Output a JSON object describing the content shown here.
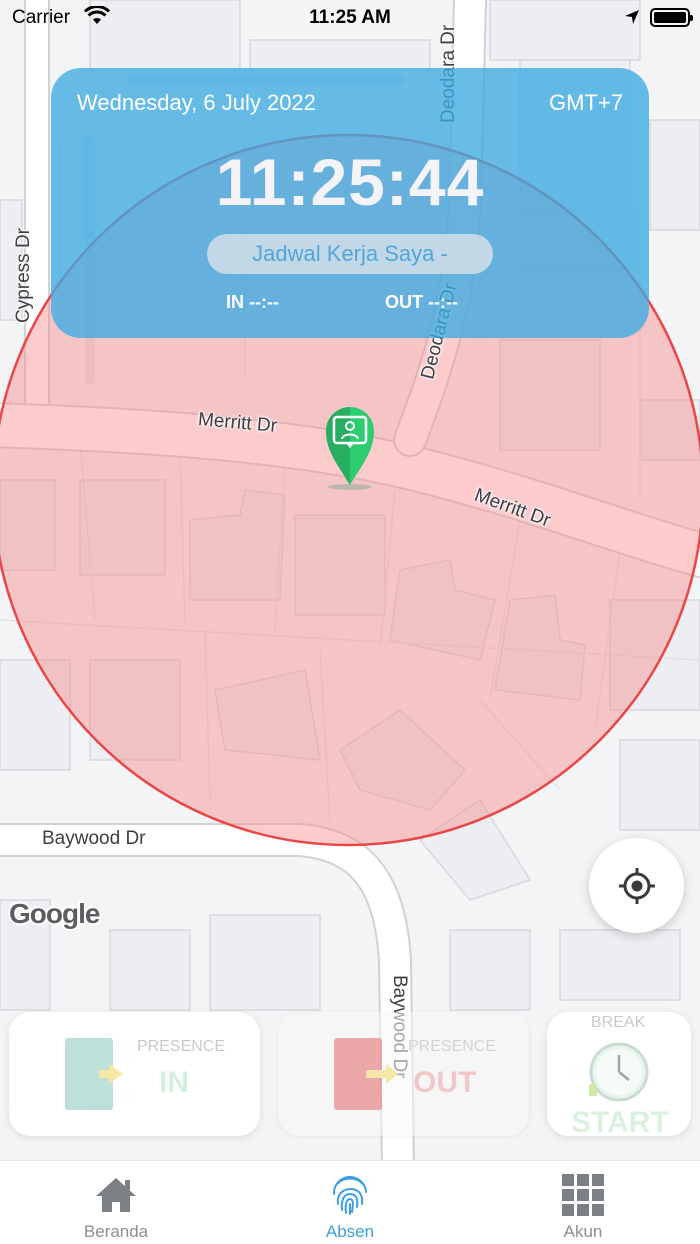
{
  "status_bar": {
    "carrier": "Carrier",
    "time": "11:25 AM"
  },
  "header": {
    "date": "Wednesday, 6 July 2022",
    "timezone": "GMT+7",
    "clock": "11:25:44",
    "schedule_label": "Jadwal Kerja Saya  -",
    "in_label": "IN --:--",
    "out_label": "OUT --:--"
  },
  "map": {
    "roads": {
      "cypress": "Cypress Dr",
      "deodara_top": "Deodara Dr",
      "deodara_mid": "Deodara Dr",
      "merritt_left": "Merritt Dr",
      "merritt_right": "Merritt Dr",
      "baywood_h": "Baywood Dr",
      "baywood_v": "Baywood Dr"
    },
    "attribution": "Google",
    "geofence_color": "#f26b6b",
    "marker_color": "#2ecc71"
  },
  "actions": {
    "presence_in": {
      "caption": "PRESENCE",
      "label": "IN"
    },
    "presence_out": {
      "caption": "PRESENCE",
      "label": "OUT"
    },
    "break": {
      "caption": "BREAK",
      "label": "START"
    }
  },
  "nav": {
    "items": [
      {
        "label": "Beranda",
        "icon": "home-icon"
      },
      {
        "label": "Absen",
        "icon": "fingerprint-icon",
        "active": true
      },
      {
        "label": "Akun",
        "icon": "grid-icon"
      }
    ],
    "active_color": "#3b9fe0",
    "inactive_color": "#8b8e93"
  }
}
